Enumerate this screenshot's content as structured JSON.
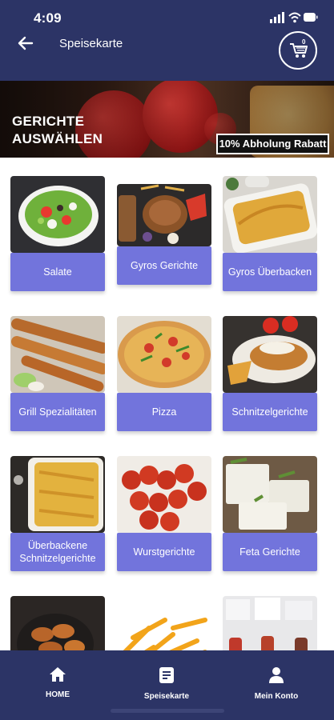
{
  "status_bar": {
    "time": "4:09"
  },
  "header": {
    "title": "Speisekarte",
    "cart_count": "0"
  },
  "banner": {
    "title": "GERICHTE AUSWÄHLEN",
    "badge": "10% Abholung Rabatt"
  },
  "categories": [
    {
      "label": "Salate",
      "image": "salad"
    },
    {
      "label": "Gyros Gerichte",
      "image": "gyros-plate"
    },
    {
      "label": "Gyros Überbacken",
      "image": "gyros-baked"
    },
    {
      "label": "Grill Spezialitäten",
      "image": "grill-skewers"
    },
    {
      "label": "Pizza",
      "image": "pizza"
    },
    {
      "label": "Schnitzelgerichte",
      "image": "schnitzel"
    },
    {
      "label": "Überbackene Schnitzelgerichte",
      "image": "baked-schnitzel"
    },
    {
      "label": "Wurstgerichte",
      "image": "sausage"
    },
    {
      "label": "Feta Gerichte",
      "image": "feta"
    },
    {
      "label": "",
      "image": "chicken-wings"
    },
    {
      "label": "",
      "image": "fries"
    },
    {
      "label": "",
      "image": "sauces"
    }
  ],
  "bottom_nav": [
    {
      "label": "HOME",
      "icon": "home-icon"
    },
    {
      "label": "Speisekarte",
      "icon": "menu-icon"
    },
    {
      "label": "Mein Konto",
      "icon": "account-icon"
    }
  ],
  "colors": {
    "primary": "#2c3466",
    "card_label": "#7274dc",
    "banner_badge_bg": "#111111"
  }
}
